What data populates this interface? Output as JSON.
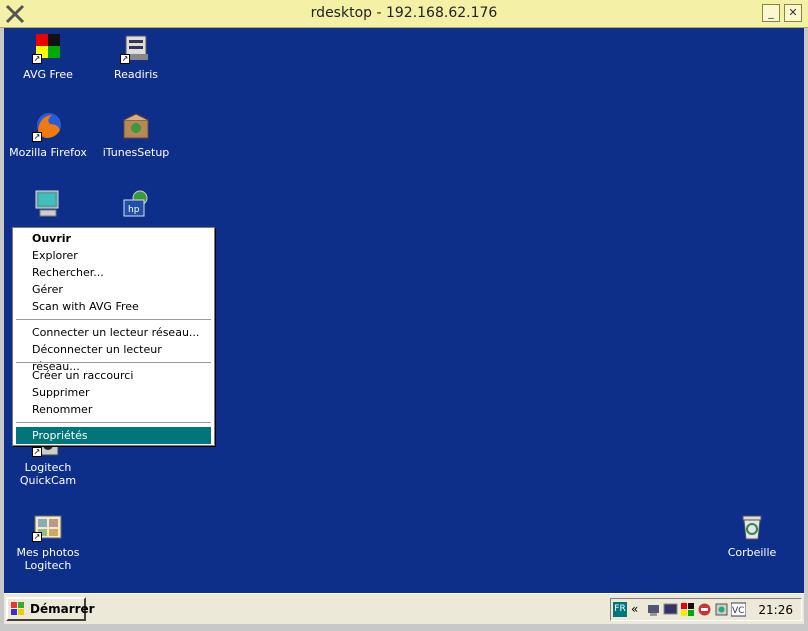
{
  "window": {
    "title": "rdesktop - 192.168.62.176",
    "minimize_label": "_",
    "close_label": "✕"
  },
  "desktop_icons": [
    {
      "label": "AVG Free",
      "icon": "avg-icon"
    },
    {
      "label": "Readiris",
      "icon": "readiris-icon"
    },
    {
      "label": "Mozilla Firefox",
      "icon": "firefox-icon"
    },
    {
      "label": "iTunesSetup",
      "icon": "itunes-setup-icon"
    },
    {
      "label": "",
      "icon": "my-computer-icon"
    },
    {
      "label": "",
      "icon": "hp-icon"
    },
    {
      "label": "Logitech QuickCam",
      "icon": "webcam-icon"
    },
    {
      "label": "Mes photos Logitech",
      "icon": "photos-icon"
    },
    {
      "label": "Corbeille",
      "icon": "recycle-bin-icon"
    }
  ],
  "context_menu": {
    "items": [
      {
        "label": "Ouvrir",
        "bold": true
      },
      {
        "label": "Explorer"
      },
      {
        "label": "Rechercher..."
      },
      {
        "label": "Gérer"
      },
      {
        "label": "Scan with AVG Free"
      },
      {
        "label": "Connecter un lecteur réseau..."
      },
      {
        "label": "Déconnecter un lecteur réseau..."
      },
      {
        "label": "Créer un raccourci"
      },
      {
        "label": "Supprimer"
      },
      {
        "label": "Renommer"
      },
      {
        "label": "Propriétés",
        "highlighted": true
      }
    ]
  },
  "taskbar": {
    "start_label": "Démarrer",
    "lang": "FR",
    "chevron": "«",
    "clock": "21:26"
  },
  "colors": {
    "desktop": "#0d2f8a",
    "title_bar": "#f4f0a6",
    "menu_highlight": "#00767a",
    "taskbar": "#ece9d8"
  }
}
